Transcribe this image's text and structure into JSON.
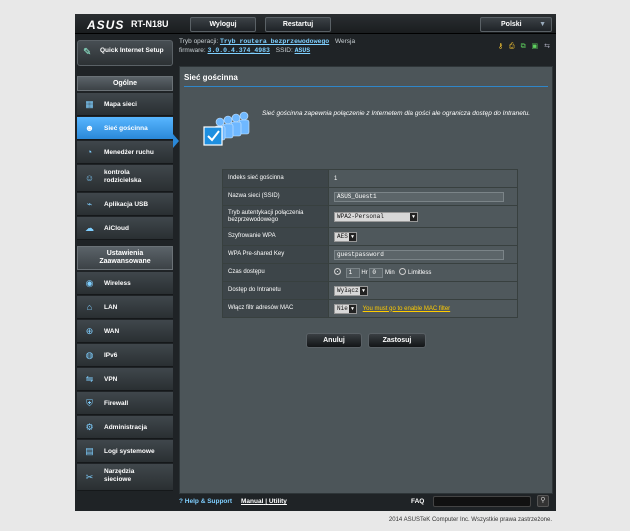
{
  "header": {
    "logo": "ASUS",
    "model": "RT-N18U",
    "logout_label": "Wyloguj",
    "restart_label": "Restartuj",
    "language": "Polski"
  },
  "infobar": {
    "mode_label": "Tryb operacji:",
    "mode_value": "Tryb routera bezprzewodowego",
    "version_label": "Wersja",
    "firmware_label": "firmware:",
    "firmware_value": "3.0.0.4.374_4983",
    "ssid_label": "SSID:",
    "ssid_value": "ASUS"
  },
  "sidebar": {
    "qis_label": "Quick Internet Setup",
    "general_header": "Ogólne",
    "general_items": [
      {
        "label": "Mapa sieci",
        "icon": "network-map-icon"
      },
      {
        "label": "Sieć gościnna",
        "icon": "guest-network-icon"
      },
      {
        "label": "Menedżer ruchu",
        "icon": "traffic-manager-icon"
      },
      {
        "label": "kontrola rodzicielska",
        "icon": "parental-control-icon"
      },
      {
        "label": "Aplikacja USB",
        "icon": "usb-icon"
      },
      {
        "label": "AiCloud",
        "icon": "cloud-icon"
      }
    ],
    "advanced_header": "Ustawienia Zaawansowane",
    "advanced_items": [
      {
        "label": "Wireless",
        "icon": "wireless-icon"
      },
      {
        "label": "LAN",
        "icon": "lan-icon"
      },
      {
        "label": "WAN",
        "icon": "wan-icon"
      },
      {
        "label": "IPv6",
        "icon": "ipv6-icon"
      },
      {
        "label": "VPN",
        "icon": "vpn-icon"
      },
      {
        "label": "Firewall",
        "icon": "firewall-icon"
      },
      {
        "label": "Administracja",
        "icon": "admin-icon"
      },
      {
        "label": "Logi systemowe",
        "icon": "log-icon"
      },
      {
        "label": "Narzędzia sieciowe",
        "icon": "tools-icon"
      }
    ]
  },
  "content": {
    "title": "Sieć gościnna",
    "description": "Sieć gościnna zapewnia połączenie z Internetem dla gości ale ogranicza dostęp do Intranetu.",
    "rows": {
      "index_label": "Indeks sieć gościnna",
      "index_value": "1",
      "ssid_label": "Nazwa sieci (SSID)",
      "ssid_value": "ASUS_Guest1",
      "auth_label": "Tryb autentykacji połączenia bezprzewodowego",
      "auth_value": "WPA2-Personal",
      "wpa_enc_label": "Szyfrowanie WPA",
      "wpa_enc_value": "AES",
      "psk_label": "WPA Pre-shared Key",
      "psk_value": "guestpassword",
      "access_time_label": "Czas dostępu",
      "hr_value": "1",
      "hr_unit": "Hr",
      "min_value": "0",
      "min_unit": "Min",
      "limitless_label": "Limitless",
      "intranet_label": "Dostęp do Intranetu",
      "intranet_value": "Wyłącz",
      "mac_label": "Włącz filtr adresów MAC",
      "mac_value": "Nie",
      "mac_link": "You must go to enable MAC filter"
    },
    "cancel_label": "Anuluj",
    "apply_label": "Zastosuj"
  },
  "footer": {
    "help_label": "Help & Support",
    "manual_label": "Manual",
    "separator": "|",
    "utility_label": "Utility",
    "faq_label": "FAQ"
  },
  "copyright": "2014 ASUSTeK Computer Inc. Wszystkie prawa zastrzeżone."
}
